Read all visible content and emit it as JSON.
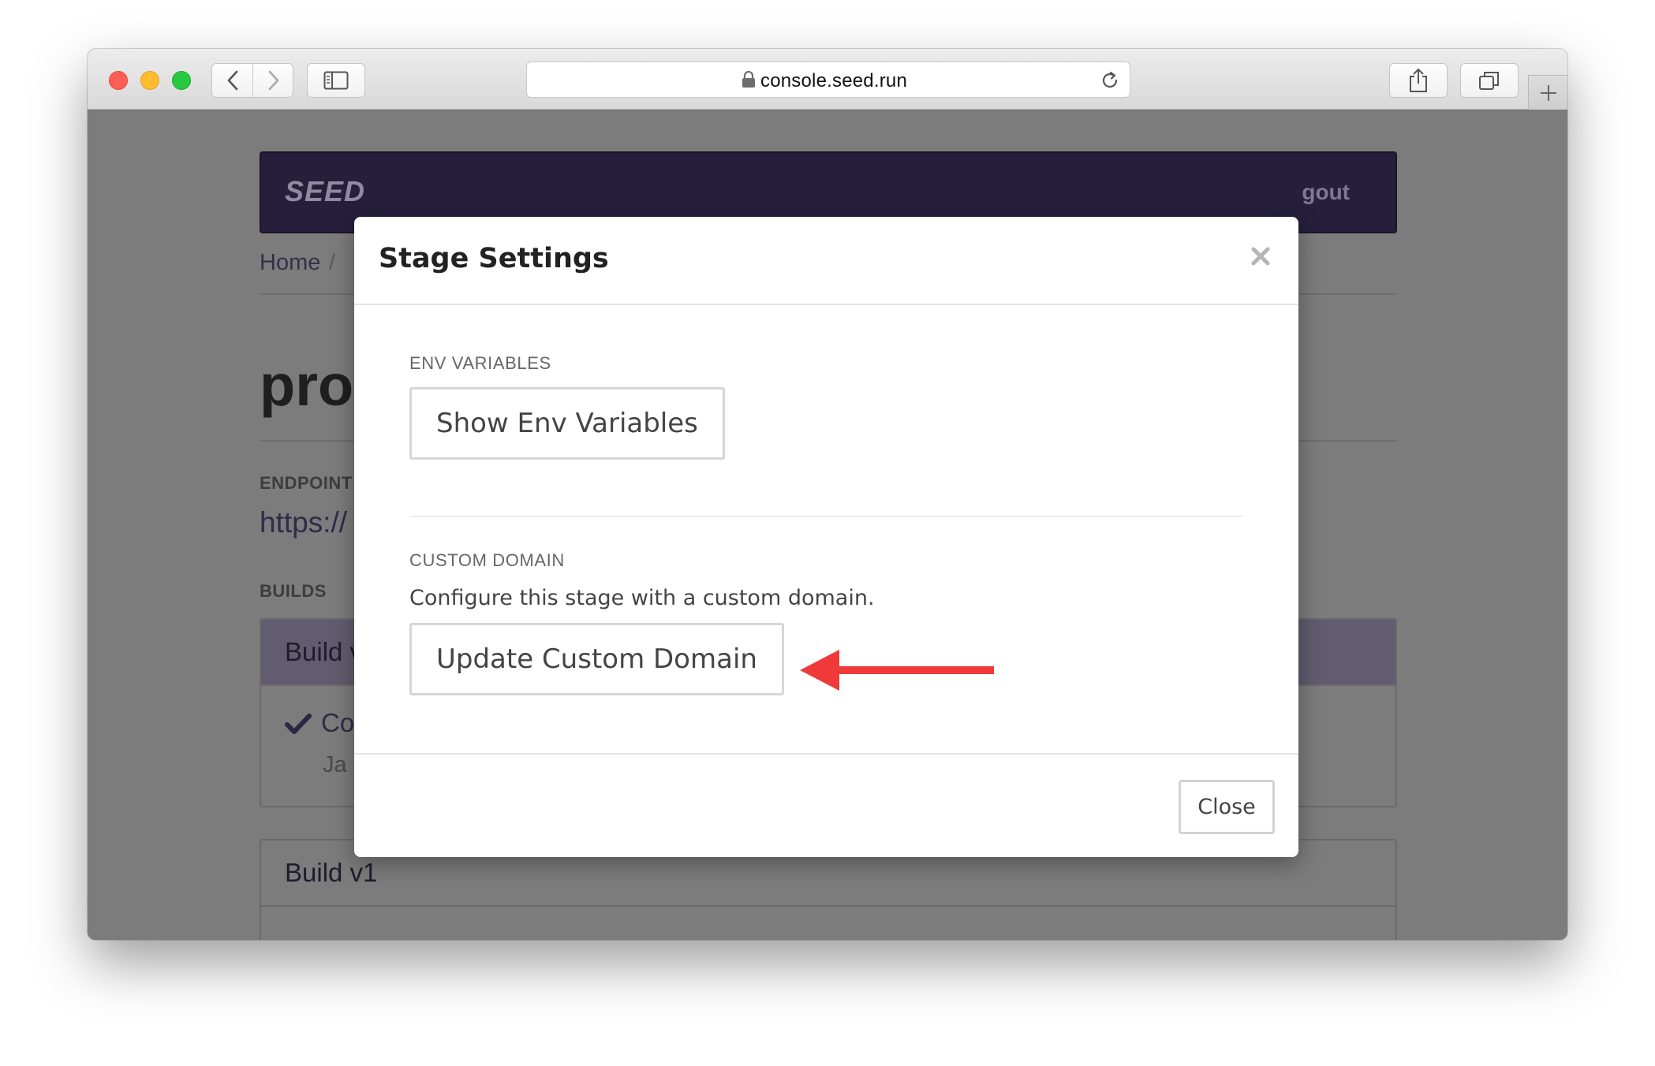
{
  "browser": {
    "url": "console.seed.run",
    "colors": {
      "close": "#fd5f57",
      "minimize": "#febc2e",
      "zoom": "#28c840"
    },
    "icons": [
      "back-icon",
      "forward-icon",
      "sidebar-icon",
      "lock-icon",
      "reload-icon",
      "share-icon",
      "tabs-icon",
      "plus-icon"
    ]
  },
  "app": {
    "brand": "SEED",
    "logout": "gout",
    "breadcrumb_home": "Home",
    "breadcrumb_sep": "/",
    "page_title": "pro",
    "endpoint_label": "ENDPOINT",
    "endpoint_value": "https://",
    "builds_label": "BUILDS",
    "builds": [
      {
        "title": "Build v",
        "message": "Co",
        "author": "Ja"
      },
      {
        "title": "Build v1"
      }
    ]
  },
  "modal": {
    "title": "Stage Settings",
    "env_label": "ENV VARIABLES",
    "env_button": "Show Env Variables",
    "domain_label": "CUSTOM DOMAIN",
    "domain_description": "Configure this stage with a custom domain.",
    "domain_button": "Update Custom Domain",
    "close_button": "Close",
    "arrow_color": "#f03a3a"
  }
}
